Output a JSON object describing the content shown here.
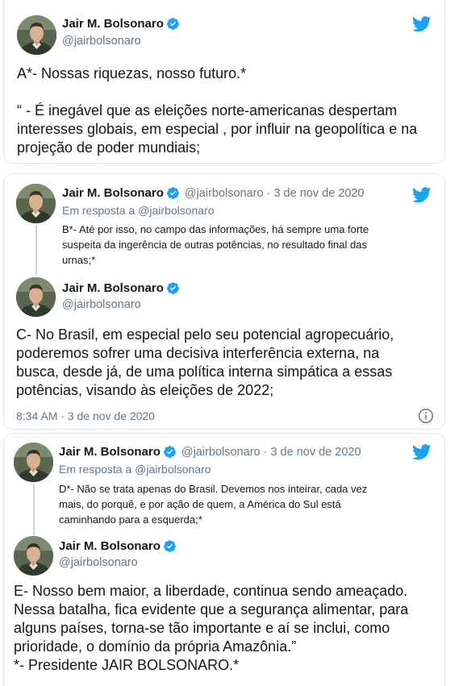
{
  "colors": {
    "twitter_blue": "#1da1f2",
    "text": "#14171a",
    "muted": "#657786",
    "border": "#e1e8ed"
  },
  "icons": {
    "logo": "twitter-bird-icon",
    "verified": "verified-badge-icon",
    "info": "info-icon"
  },
  "card1": {
    "name": "Jair M. Bolsonaro",
    "handle": "@jairbolsonaro",
    "lines": [
      "A*- Nossas riquezas, nosso futuro.*",
      "",
      "“ - É inegável que as eleições norte-americanas despertam",
      "interesses globais, em especial , por influir na geopolítica e na",
      "projeção de poder mundiais;"
    ]
  },
  "card2": {
    "parent": {
      "name": "Jair M. Bolsonaro",
      "handle": "@jairbolsonaro",
      "date": "· 3 de nov de 2020",
      "reply_to": "Em resposta a @jairbolsonaro",
      "lines": [
        "B*- Até por isso, no campo das informações, há sempre uma forte",
        "suspeita da ingerência de outras potências, no resultado final das",
        "urnas;*"
      ]
    },
    "main": {
      "name": "Jair M. Bolsonaro",
      "handle": "@jairbolsonaro",
      "lines": [
        "C- No Brasil, em especial pelo seu potencial agropecuário,",
        "poderemos sofrer uma decisiva interferência externa, na",
        "busca, desde já, de uma política interna simpática a essas",
        "potências, visando  às eleições de 2022;"
      ],
      "timestamp": "8:34 AM · 3 de nov de 2020"
    }
  },
  "card3": {
    "parent": {
      "name": "Jair M. Bolsonaro",
      "handle": "@jairbolsonaro",
      "date": "· 3 de nov de 2020",
      "reply_to": "Em resposta a @jairbolsonaro",
      "lines": [
        "D*- Não se trata apenas do Brasil. Devemos nos inteirar, cada vez",
        "mais, do porquê, e por ação de quem, a América do Sul está",
        "caminhando para a esquerda;*"
      ]
    },
    "main": {
      "name": "Jair M. Bolsonaro",
      "handle": "@jairbolsonaro",
      "lines": [
        "E- Nosso bem maior, a liberdade, continua sendo ameaçado.",
        "Nessa batalha, fica evidente que a segurança alimentar, para",
        "alguns países, torna-se tão importante e aí se inclui, como",
        "prioridade, o domínio da própria Amazônia.”",
        "*- Presidente JAIR BOLSONARO.*"
      ]
    }
  }
}
